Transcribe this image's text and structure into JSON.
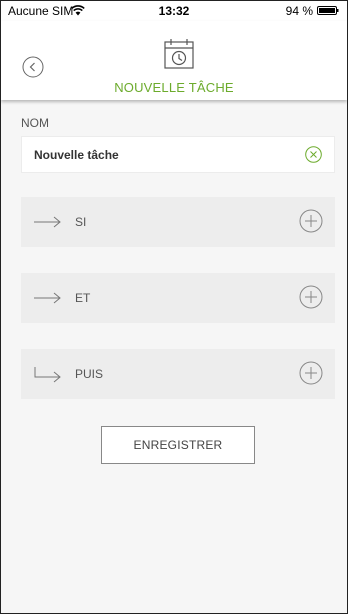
{
  "status_bar": {
    "carrier": "Aucune SIM",
    "time": "13:32",
    "battery_pct": "94 %"
  },
  "header": {
    "title": "NOUVELLE TÂCHE",
    "accent_color": "#6cab2c"
  },
  "name_section": {
    "label": "NOM",
    "value": "Nouvelle tâche"
  },
  "rules": [
    {
      "label": "SI",
      "icon": "arrow-right-icon"
    },
    {
      "label": "ET",
      "icon": "arrow-right-icon"
    },
    {
      "label": "PUIS",
      "icon": "arrow-return-right-icon"
    }
  ],
  "save_label": "ENREGISTRER"
}
